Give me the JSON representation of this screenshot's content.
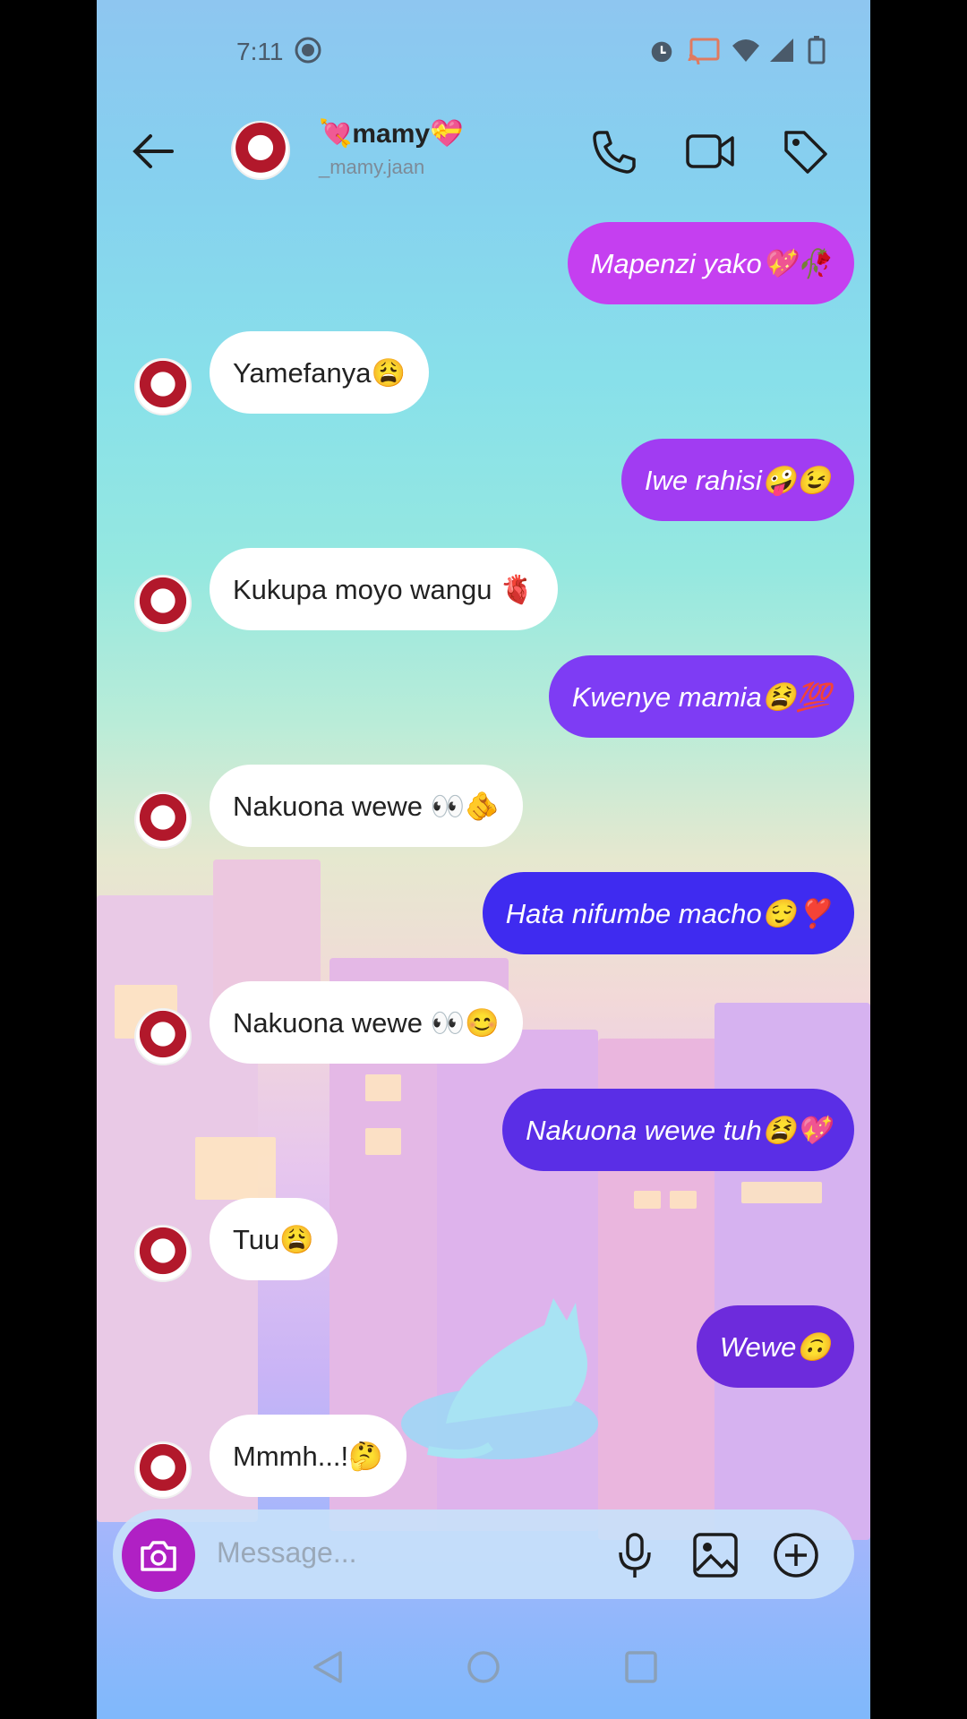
{
  "status_bar": {
    "time": "7:11"
  },
  "header": {
    "name": "💘mamy💝",
    "username": "_mamy.jaan"
  },
  "messages": [
    {
      "dir": "out",
      "text": "Mapenzi yako💖🥀"
    },
    {
      "dir": "in",
      "text": "Yamefanya😩"
    },
    {
      "dir": "out",
      "text": "Iwe rahisi🤪😉"
    },
    {
      "dir": "in",
      "text": "Kukupa moyo wangu 🫀"
    },
    {
      "dir": "out",
      "text": "Kwenye mamia😫💯"
    },
    {
      "dir": "in",
      "text": "Nakuona wewe 👀🫵"
    },
    {
      "dir": "out",
      "text": "Hata nifumbe macho😌❣️"
    },
    {
      "dir": "in",
      "text": "Nakuona wewe 👀😊"
    },
    {
      "dir": "out",
      "text": "Nakuona wewe tuh😫💖"
    },
    {
      "dir": "in",
      "text": "Tuu😩"
    },
    {
      "dir": "out",
      "text": "Wewe🙃"
    },
    {
      "dir": "in",
      "text": "Mmmh...!🤔"
    }
  ],
  "composer": {
    "placeholder": "Message..."
  },
  "colors": {
    "out_bubbles": [
      "#c53ff0",
      "#a13cf2",
      "#7e3cf4",
      "#3f2bf0",
      "#5a2ee6",
      "#6d2bdc"
    ],
    "camera": "#b020c4"
  }
}
